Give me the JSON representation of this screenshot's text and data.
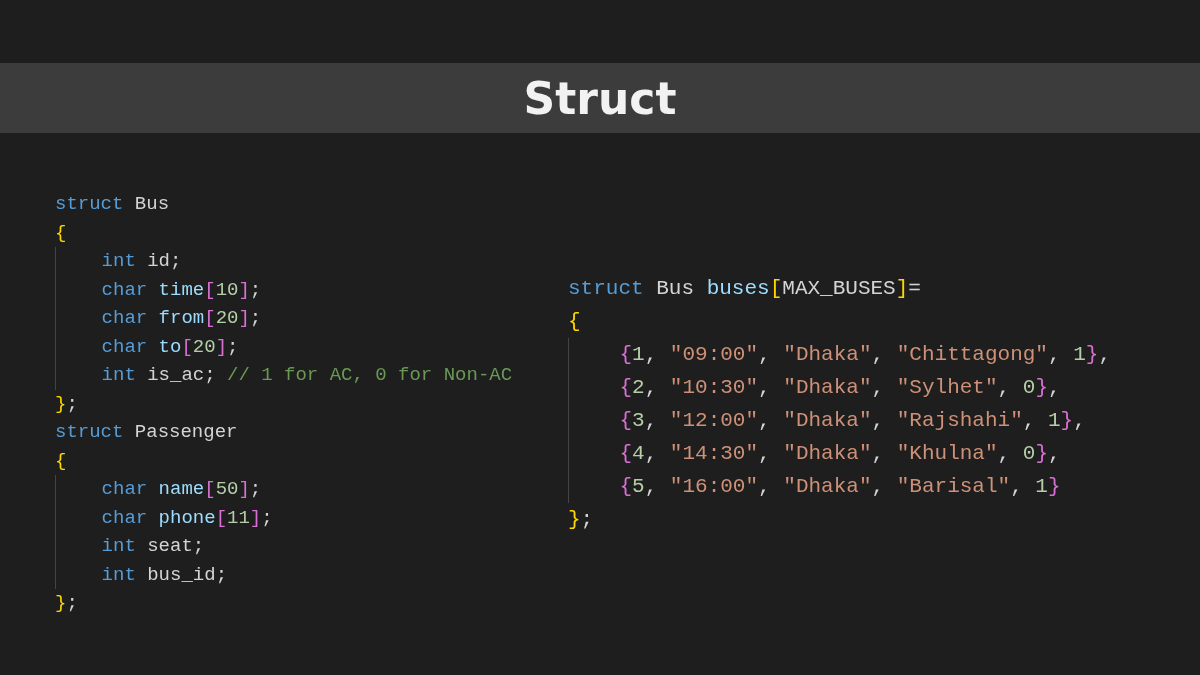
{
  "title": "Struct",
  "panels": [
    {
      "lines": [
        {
          "indented": false,
          "tokens": [
            {
              "kind": "keyword",
              "text": "struct"
            },
            {
              "kind": "plain",
              "text": " Bus"
            }
          ]
        },
        {
          "indented": false,
          "tokens": [
            {
              "kind": "bracket1",
              "text": "{"
            }
          ]
        },
        {
          "indented": true,
          "tokens": [
            {
              "kind": "keyword",
              "text": "int"
            },
            {
              "kind": "plain",
              "text": " id;"
            }
          ]
        },
        {
          "indented": true,
          "tokens": [
            {
              "kind": "keyword",
              "text": "char"
            },
            {
              "kind": "variable",
              "text": " time"
            },
            {
              "kind": "bracket2",
              "text": "["
            },
            {
              "kind": "number",
              "text": "10"
            },
            {
              "kind": "bracket2",
              "text": "]"
            },
            {
              "kind": "plain",
              "text": ";"
            }
          ]
        },
        {
          "indented": true,
          "tokens": [
            {
              "kind": "keyword",
              "text": "char"
            },
            {
              "kind": "variable",
              "text": " from"
            },
            {
              "kind": "bracket2",
              "text": "["
            },
            {
              "kind": "number",
              "text": "20"
            },
            {
              "kind": "bracket2",
              "text": "]"
            },
            {
              "kind": "plain",
              "text": ";"
            }
          ]
        },
        {
          "indented": true,
          "tokens": [
            {
              "kind": "keyword",
              "text": "char"
            },
            {
              "kind": "variable",
              "text": " to"
            },
            {
              "kind": "bracket2",
              "text": "["
            },
            {
              "kind": "number",
              "text": "20"
            },
            {
              "kind": "bracket2",
              "text": "]"
            },
            {
              "kind": "plain",
              "text": ";"
            }
          ]
        },
        {
          "indented": true,
          "tokens": [
            {
              "kind": "keyword",
              "text": "int"
            },
            {
              "kind": "plain",
              "text": " is_ac;"
            },
            {
              "kind": "comment",
              "text": " // 1 for AC, 0 for Non-AC"
            }
          ]
        },
        {
          "indented": false,
          "tokens": [
            {
              "kind": "bracket1",
              "text": "}"
            },
            {
              "kind": "plain",
              "text": ";"
            }
          ]
        },
        {
          "indented": false,
          "tokens": [
            {
              "kind": "keyword",
              "text": "struct"
            },
            {
              "kind": "plain",
              "text": " Passenger"
            }
          ]
        },
        {
          "indented": false,
          "tokens": [
            {
              "kind": "bracket1",
              "text": "{"
            }
          ]
        },
        {
          "indented": true,
          "tokens": [
            {
              "kind": "keyword",
              "text": "char"
            },
            {
              "kind": "variable",
              "text": " name"
            },
            {
              "kind": "bracket2",
              "text": "["
            },
            {
              "kind": "number",
              "text": "50"
            },
            {
              "kind": "bracket2",
              "text": "]"
            },
            {
              "kind": "plain",
              "text": ";"
            }
          ]
        },
        {
          "indented": true,
          "tokens": [
            {
              "kind": "keyword",
              "text": "char"
            },
            {
              "kind": "variable",
              "text": " phone"
            },
            {
              "kind": "bracket2",
              "text": "["
            },
            {
              "kind": "number",
              "text": "11"
            },
            {
              "kind": "bracket2",
              "text": "]"
            },
            {
              "kind": "plain",
              "text": ";"
            }
          ]
        },
        {
          "indented": true,
          "tokens": [
            {
              "kind": "keyword",
              "text": "int"
            },
            {
              "kind": "plain",
              "text": " seat;"
            }
          ]
        },
        {
          "indented": true,
          "tokens": [
            {
              "kind": "keyword",
              "text": "int"
            },
            {
              "kind": "plain",
              "text": " bus_id;"
            }
          ]
        },
        {
          "indented": false,
          "tokens": [
            {
              "kind": "bracket1",
              "text": "}"
            },
            {
              "kind": "plain",
              "text": ";"
            }
          ]
        }
      ]
    },
    {
      "lines": [
        {
          "indented": false,
          "tokens": [
            {
              "kind": "keyword",
              "text": "struct"
            },
            {
              "kind": "plain",
              "text": " Bus"
            },
            {
              "kind": "variable",
              "text": " buses"
            },
            {
              "kind": "bracket1",
              "text": "["
            },
            {
              "kind": "plain",
              "text": "MAX_BUSES"
            },
            {
              "kind": "bracket1",
              "text": "]"
            },
            {
              "kind": "plain",
              "text": "="
            }
          ]
        },
        {
          "indented": false,
          "tokens": [
            {
              "kind": "bracket1",
              "text": "{"
            }
          ]
        },
        {
          "indented": true,
          "tokens": [
            {
              "kind": "bracket2",
              "text": "{"
            },
            {
              "kind": "number",
              "text": "1"
            },
            {
              "kind": "plain",
              "text": ", "
            },
            {
              "kind": "string",
              "text": "\"09:00\""
            },
            {
              "kind": "plain",
              "text": ", "
            },
            {
              "kind": "string",
              "text": "\"Dhaka\""
            },
            {
              "kind": "plain",
              "text": ", "
            },
            {
              "kind": "string",
              "text": "\"Chittagong\""
            },
            {
              "kind": "plain",
              "text": ", "
            },
            {
              "kind": "number",
              "text": "1"
            },
            {
              "kind": "bracket2",
              "text": "}"
            },
            {
              "kind": "plain",
              "text": ","
            }
          ]
        },
        {
          "indented": true,
          "tokens": [
            {
              "kind": "bracket2",
              "text": "{"
            },
            {
              "kind": "number",
              "text": "2"
            },
            {
              "kind": "plain",
              "text": ", "
            },
            {
              "kind": "string",
              "text": "\"10:30\""
            },
            {
              "kind": "plain",
              "text": ", "
            },
            {
              "kind": "string",
              "text": "\"Dhaka\""
            },
            {
              "kind": "plain",
              "text": ", "
            },
            {
              "kind": "string",
              "text": "\"Sylhet\""
            },
            {
              "kind": "plain",
              "text": ", "
            },
            {
              "kind": "number",
              "text": "0"
            },
            {
              "kind": "bracket2",
              "text": "}"
            },
            {
              "kind": "plain",
              "text": ","
            }
          ]
        },
        {
          "indented": true,
          "tokens": [
            {
              "kind": "bracket2",
              "text": "{"
            },
            {
              "kind": "number",
              "text": "3"
            },
            {
              "kind": "plain",
              "text": ", "
            },
            {
              "kind": "string",
              "text": "\"12:00\""
            },
            {
              "kind": "plain",
              "text": ", "
            },
            {
              "kind": "string",
              "text": "\"Dhaka\""
            },
            {
              "kind": "plain",
              "text": ", "
            },
            {
              "kind": "string",
              "text": "\"Rajshahi\""
            },
            {
              "kind": "plain",
              "text": ", "
            },
            {
              "kind": "number",
              "text": "1"
            },
            {
              "kind": "bracket2",
              "text": "}"
            },
            {
              "kind": "plain",
              "text": ","
            }
          ]
        },
        {
          "indented": true,
          "tokens": [
            {
              "kind": "bracket2",
              "text": "{"
            },
            {
              "kind": "number",
              "text": "4"
            },
            {
              "kind": "plain",
              "text": ", "
            },
            {
              "kind": "string",
              "text": "\"14:30\""
            },
            {
              "kind": "plain",
              "text": ", "
            },
            {
              "kind": "string",
              "text": "\"Dhaka\""
            },
            {
              "kind": "plain",
              "text": ", "
            },
            {
              "kind": "string",
              "text": "\"Khulna\""
            },
            {
              "kind": "plain",
              "text": ", "
            },
            {
              "kind": "number",
              "text": "0"
            },
            {
              "kind": "bracket2",
              "text": "}"
            },
            {
              "kind": "plain",
              "text": ","
            }
          ]
        },
        {
          "indented": true,
          "tokens": [
            {
              "kind": "bracket2",
              "text": "{"
            },
            {
              "kind": "number",
              "text": "5"
            },
            {
              "kind": "plain",
              "text": ", "
            },
            {
              "kind": "string",
              "text": "\"16:00\""
            },
            {
              "kind": "plain",
              "text": ", "
            },
            {
              "kind": "string",
              "text": "\"Dhaka\""
            },
            {
              "kind": "plain",
              "text": ", "
            },
            {
              "kind": "string",
              "text": "\"Barisal\""
            },
            {
              "kind": "plain",
              "text": ", "
            },
            {
              "kind": "number",
              "text": "1"
            },
            {
              "kind": "bracket2",
              "text": "}"
            }
          ]
        },
        {
          "indented": false,
          "tokens": [
            {
              "kind": "bracket1",
              "text": "}"
            },
            {
              "kind": "plain",
              "text": ";"
            }
          ]
        }
      ]
    }
  ]
}
